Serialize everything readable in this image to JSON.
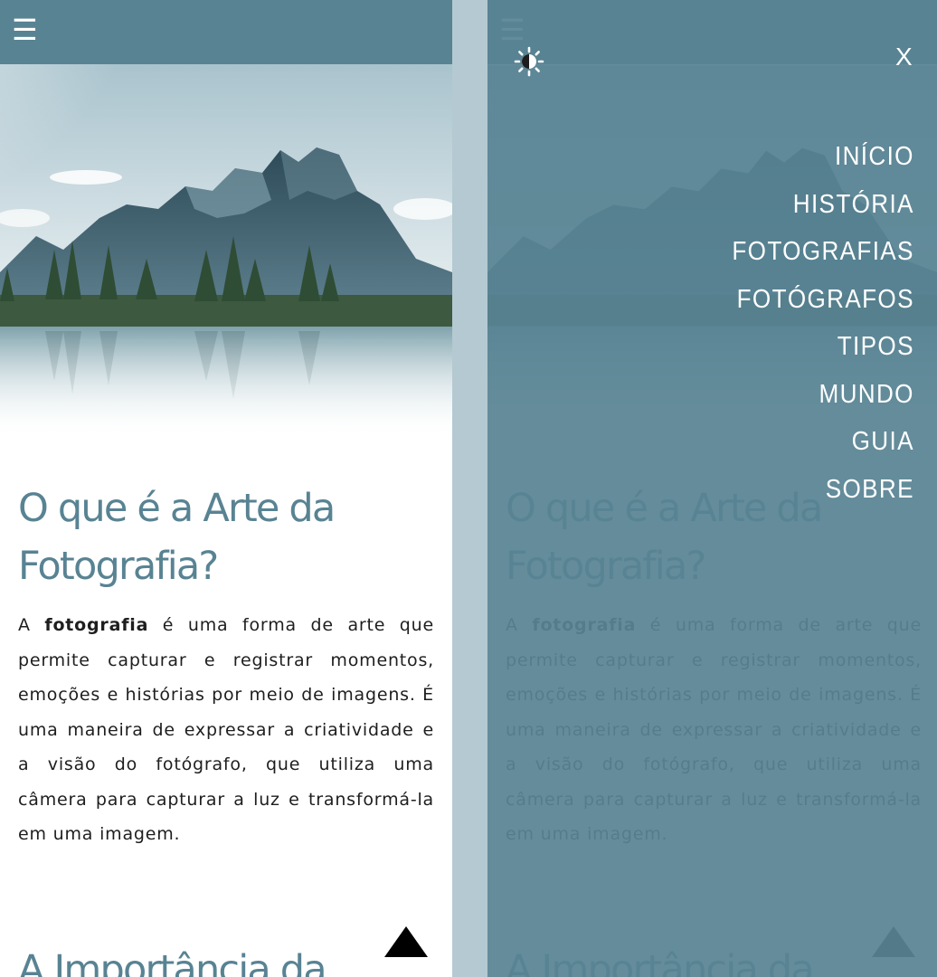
{
  "header": {
    "menu_icon": "☰"
  },
  "article": {
    "title": "O que é a Arte da Fotografia?",
    "intro_term": "fotografia",
    "intro_prefix": "A ",
    "intro_rest": " é uma forma de arte que permite capturar e registrar momentos, emoções e histórias por meio de imagens. É uma maneira de expressar a criatividade e a visão do fotógrafo, que utiliza uma câmera para capturar a luz e transformá-la em uma imagem.",
    "next_heading": "A Importância da"
  },
  "menu": {
    "close_label": "X",
    "theme_icon": "sun-icon",
    "items": [
      "INÍCIO",
      "HISTÓRIA",
      "FOTOGRAFIAS",
      "FOTÓGRAFOS",
      "TIPOS",
      "MUNDO",
      "GUIA",
      "SOBRE"
    ]
  },
  "colors": {
    "accent": "#588393",
    "background": "#b4c9d1",
    "text": "#1e1e1e",
    "overlay": "#588393"
  }
}
